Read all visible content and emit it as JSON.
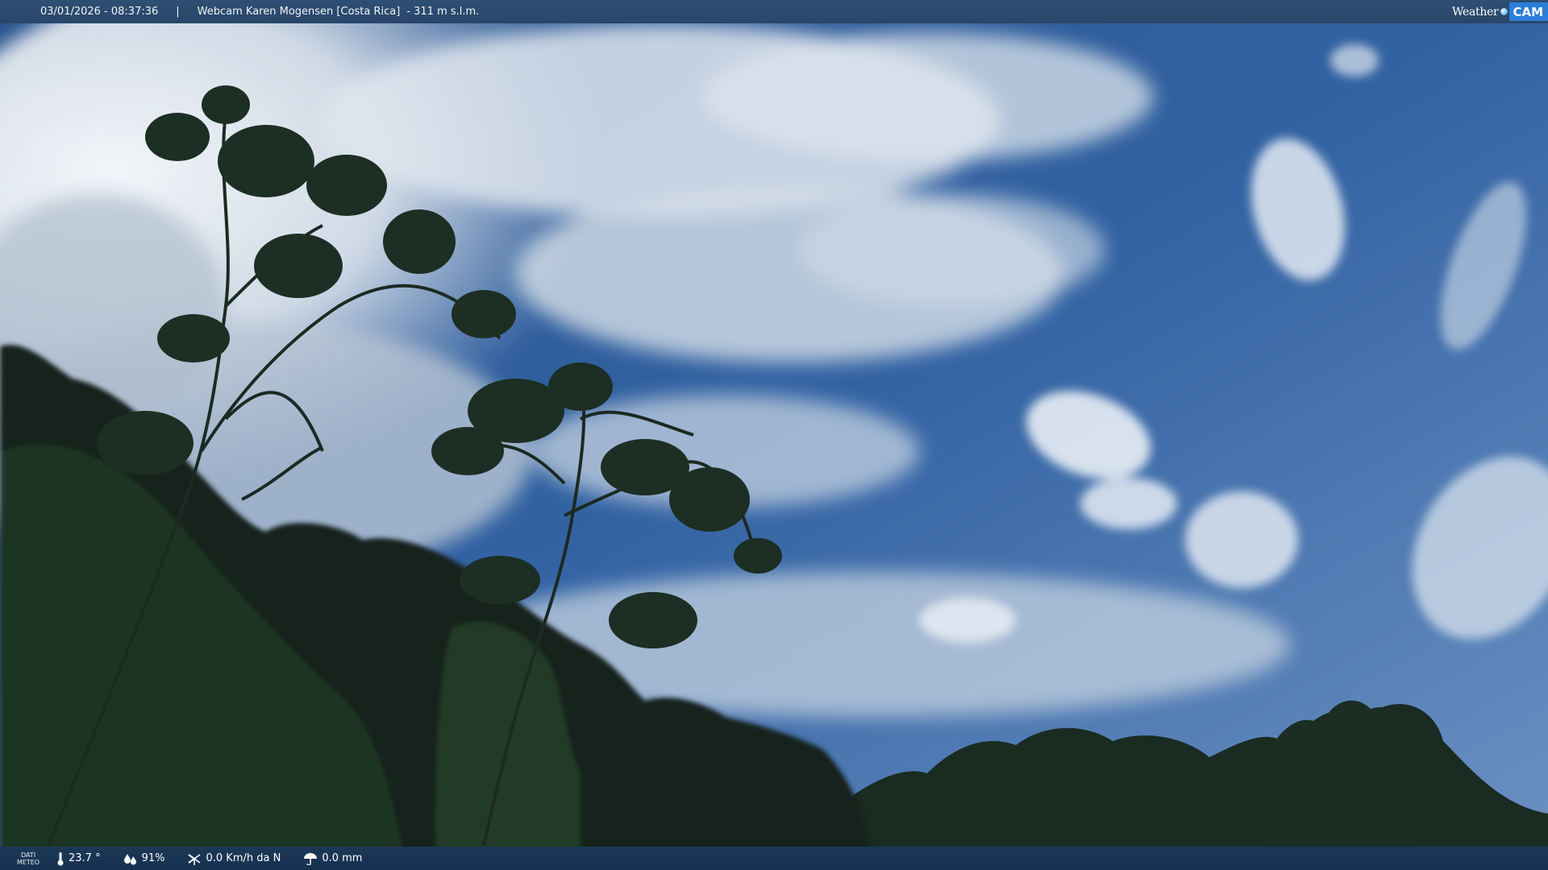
{
  "header": {
    "datetime": "03/01/2026 - 08:37:36",
    "separator": "|",
    "webcam_title": "Webcam Karen Mogensen [Costa Rica]",
    "altitude": "- 311 m s.l.m.",
    "brand_word": "Weather",
    "brand_cam": "CAM",
    "brand_icon": "globe-dot-icon"
  },
  "footer": {
    "label_line1": "DATI",
    "label_line2": "METEO",
    "temperature": "23.7 °",
    "humidity": "91%",
    "wind": "0.0 Km/h da N",
    "rain": "0.0 mm",
    "icons": [
      "thermometer-icon",
      "humidity-drops-icon",
      "wind-icon",
      "umbrella-icon"
    ]
  },
  "colors": {
    "sky_top": "#2f5e9c",
    "sky_horizon": "#6f93c4",
    "cloud": "#e9eef3",
    "vegetation": "#1a2a20",
    "bar_top": "#284669",
    "bar_bottom": "#173150",
    "brand_accent": "#2b7fd9"
  }
}
